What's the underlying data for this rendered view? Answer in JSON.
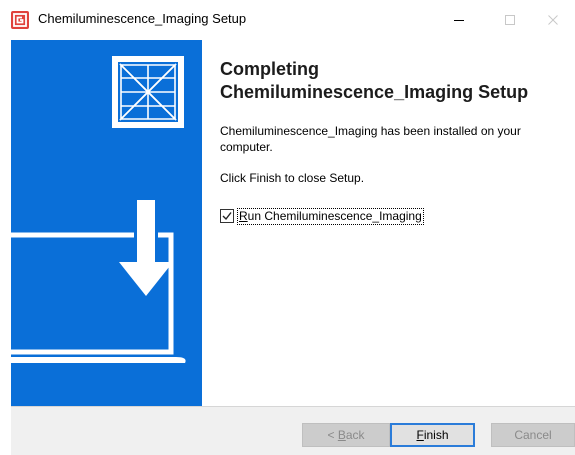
{
  "window": {
    "title": "Chemiluminescence_Imaging Setup",
    "app_icon": "installer-g-icon",
    "controls": [
      "minimize-icon",
      "maximize-icon",
      "close-icon"
    ]
  },
  "colors": {
    "banner": "#0a6fd8",
    "app_icon": "#e0413b",
    "default_button_border": "#2b7cd9"
  },
  "content": {
    "heading_line1": "Completing",
    "heading_line2": "Chemiluminescence_Imaging Setup",
    "installed_text": "Chemiluminescence_Imaging has been installed on your computer.",
    "finish_prompt": "Click Finish to close Setup.",
    "run_checkbox": {
      "checked": true,
      "mnemonic": "R",
      "label_rest": "un Chemiluminescence_Imaging"
    }
  },
  "buttons": {
    "back_pre": "< ",
    "back_mnemonic": "B",
    "back_rest": "ack",
    "finish_mnemonic": "F",
    "finish_rest": "inish",
    "cancel": "Cancel"
  }
}
